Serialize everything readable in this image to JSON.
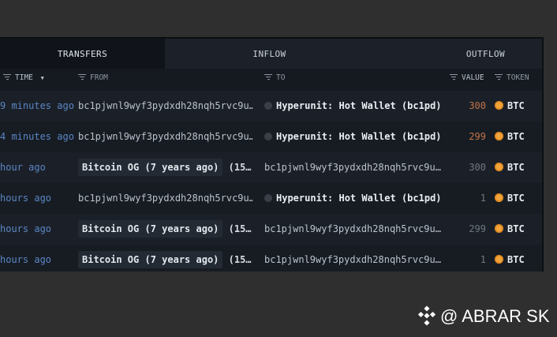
{
  "tabs": [
    "TRANSFERS",
    "INFLOW",
    "OUTFLOW"
  ],
  "columns": {
    "time": "TIME",
    "from": "FROM",
    "to": "TO",
    "value": "VALUE",
    "token": "TOKEN"
  },
  "rows": [
    {
      "time": "9 minutes ago",
      "from": "bc1pjwnl9wyf3pydxdh28nqh5rvc9u…",
      "to": "Hyperunit: Hot Wallet (bc1pd)",
      "value": "300",
      "token": "BTC"
    },
    {
      "time": "4 minutes ago",
      "from": "bc1pjwnl9wyf3pydxdh28nqh5rvc9u…",
      "to": "Hyperunit: Hot Wallet (bc1pd)",
      "value": "299",
      "token": "BTC"
    },
    {
      "time": "hour ago",
      "from": "Bitcoin OG (7 years ago)",
      "from_tail": "(15…",
      "to": "bc1pjwnl9wyf3pydxdh28nqh5rvc9u…",
      "value": "300",
      "token": "BTC"
    },
    {
      "time": "hours ago",
      "from": "bc1pjwnl9wyf3pydxdh28nqh5rvc9u…",
      "to": "Hyperunit: Hot Wallet (bc1pd)",
      "value": "1",
      "token": "BTC"
    },
    {
      "time": "hours ago",
      "from": "Bitcoin OG (7 years ago)",
      "from_tail": "(15…",
      "to": "bc1pjwnl9wyf3pydxdh28nqh5rvc9u…",
      "value": "299",
      "token": "BTC"
    },
    {
      "time": "hours ago",
      "from": "Bitcoin OG (7 years ago)",
      "from_tail": "(15…",
      "to": "bc1pjwnl9wyf3pydxdh28nqh5rvc9u…",
      "value": "1",
      "token": "BTC"
    }
  ],
  "watermark": "@ ABRAR SK",
  "colors": {
    "background": "#2f2f2f",
    "panel": "#151a21",
    "time_link": "#5a86c4",
    "value_highlight": "#c07448",
    "btc": "#f2a33a"
  }
}
